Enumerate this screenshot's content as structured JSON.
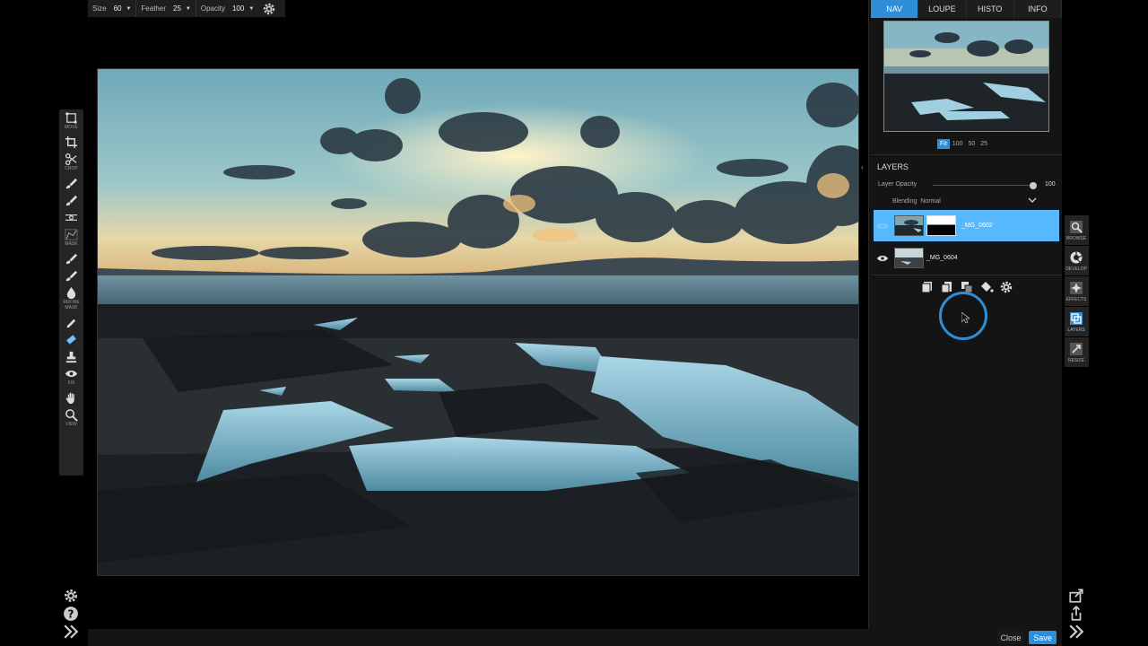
{
  "options_bar": {
    "size_label": "Size",
    "size_value": "60",
    "feather_label": "Feather",
    "feather_value": "25",
    "opacity_label": "Opacity",
    "opacity_value": "100"
  },
  "tools": [
    {
      "name": "move",
      "label": "MOVE"
    },
    {
      "name": "crop",
      "label": "CROP"
    },
    {
      "name": "mask",
      "label": "MASK"
    },
    {
      "name": "refine-mask",
      "label": "REFINE MASK"
    },
    {
      "name": "fix",
      "label": "FIX"
    },
    {
      "name": "view",
      "label": "VIEW"
    }
  ],
  "nav_tabs": [
    "NAV",
    "LOUPE",
    "HISTO",
    "INFO"
  ],
  "zoom_options": [
    "Fit",
    "100",
    "50",
    "25"
  ],
  "layers_panel": {
    "title": "LAYERS",
    "opacity_label": "Layer Opacity",
    "opacity_value": "100",
    "opacity_fraction": 1.0,
    "blending_label": "Blending",
    "blending_value": "Normal",
    "layers": [
      {
        "name": "_MG_0602",
        "selected": true
      },
      {
        "name": "_MG_0604",
        "selected": false
      }
    ]
  },
  "modules": [
    {
      "label": "BROWSE"
    },
    {
      "label": "DEVELOP"
    },
    {
      "label": "EFFECTS"
    },
    {
      "label": "LAYERS",
      "active": true
    },
    {
      "label": "RESIZE"
    }
  ],
  "footer": {
    "close_label": "Close",
    "save_label": "Save"
  },
  "colors": {
    "accent": "#2e8fd8",
    "selected_layer": "#56b8ff"
  }
}
